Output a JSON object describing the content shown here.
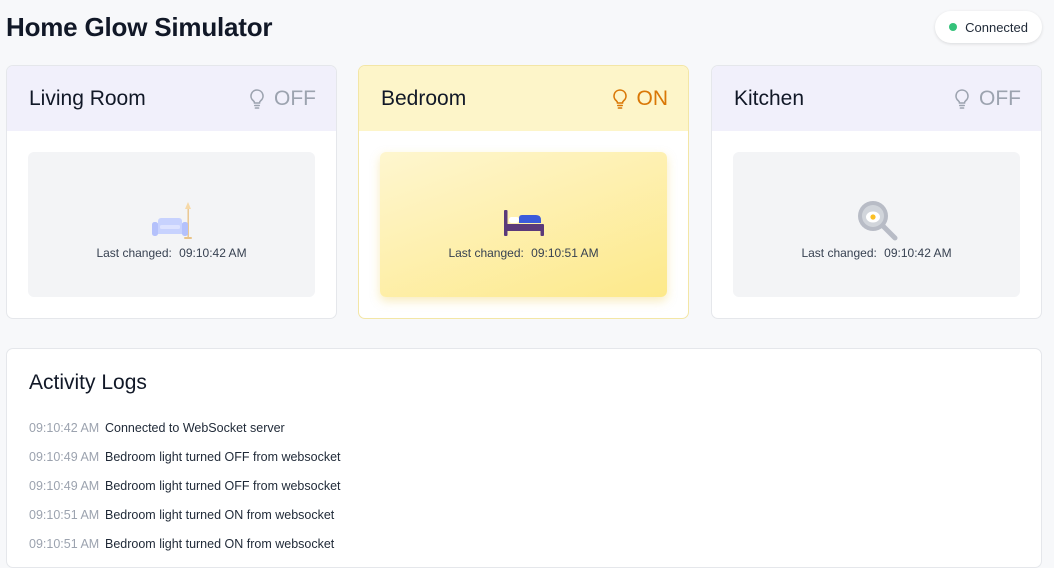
{
  "app": {
    "title": "Home Glow Simulator"
  },
  "connection": {
    "status": "Connected",
    "color": "#34c27a"
  },
  "rooms": [
    {
      "name": "Living Room",
      "state": "OFF",
      "on": false,
      "changed_label": "Last changed:",
      "changed_time": "09:10:42 AM",
      "icon": "sofa-lamp-icon"
    },
    {
      "name": "Bedroom",
      "state": "ON",
      "on": true,
      "changed_label": "Last changed:",
      "changed_time": "09:10:51 AM",
      "icon": "bed-icon"
    },
    {
      "name": "Kitchen",
      "state": "OFF",
      "on": false,
      "changed_label": "Last changed:",
      "changed_time": "09:10:42 AM",
      "icon": "frying-pan-icon"
    }
  ],
  "logs": {
    "title": "Activity Logs",
    "entries": [
      {
        "time": "09:10:42 AM",
        "message": "Connected to WebSocket server"
      },
      {
        "time": "09:10:49 AM",
        "message": "Bedroom light turned OFF from websocket"
      },
      {
        "time": "09:10:49 AM",
        "message": "Bedroom light turned OFF from websocket"
      },
      {
        "time": "09:10:51 AM",
        "message": "Bedroom light turned ON from websocket"
      },
      {
        "time": "09:10:51 AM",
        "message": "Bedroom light turned ON from websocket"
      }
    ]
  },
  "colors": {
    "on_accent": "#d97706",
    "off_text": "#9ca3af",
    "bedroom_glow": "#fde98a"
  }
}
